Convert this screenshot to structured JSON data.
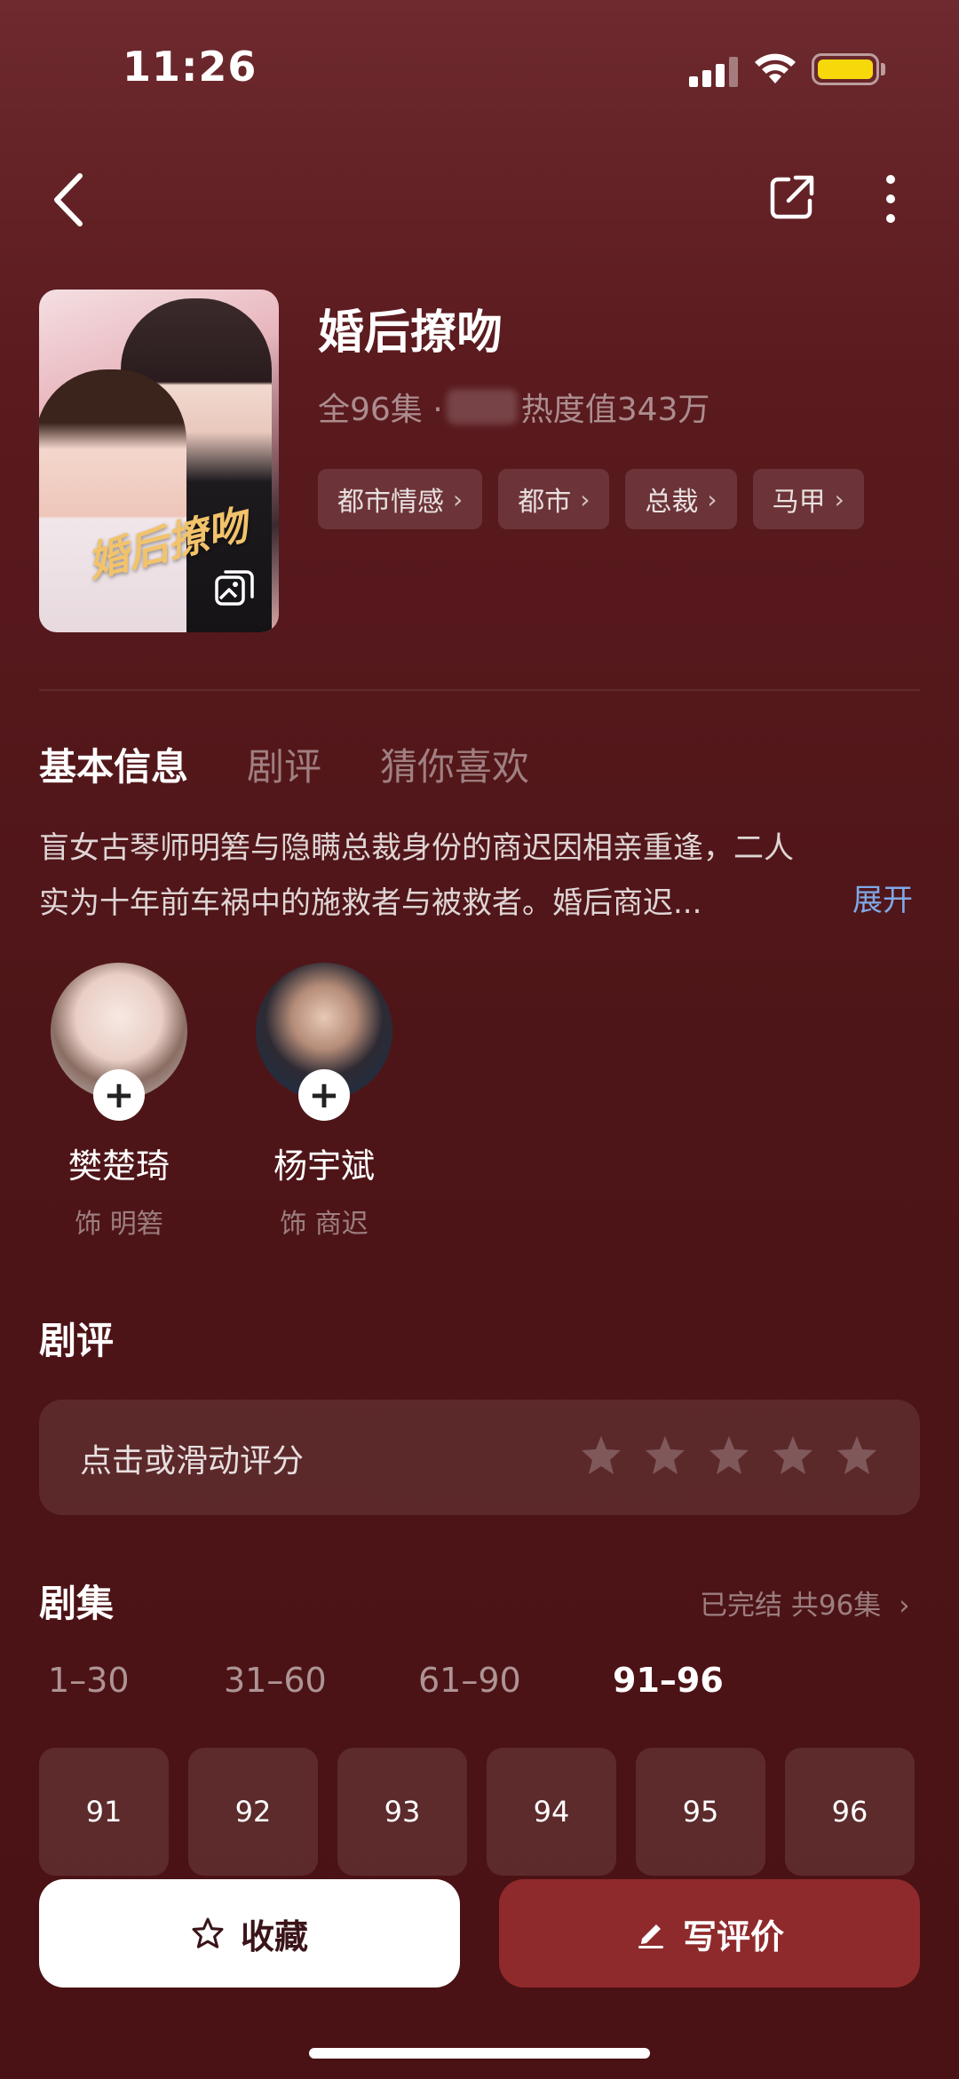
{
  "status_bar": {
    "time": "11:26"
  },
  "show": {
    "title": "婚后撩吻",
    "episodes_total_prefix": "全96集 ·",
    "heat": "热度值343万",
    "poster_title": "婚后撩吻",
    "tags": [
      {
        "label": "都市情感"
      },
      {
        "label": "都市"
      },
      {
        "label": "总裁"
      },
      {
        "label": "马甲"
      }
    ]
  },
  "tabs": [
    {
      "label": "基本信息",
      "active": true
    },
    {
      "label": "剧评",
      "active": false
    },
    {
      "label": "猜你喜欢",
      "active": false
    }
  ],
  "synopsis": {
    "line1": "盲女古琴师明箬与隐瞒总裁身份的商迟因相亲重逢，二人",
    "line2": "实为十年前车祸中的施救者与被救者。婚后商迟...",
    "expand_label": "展开"
  },
  "cast": [
    {
      "name": "樊楚琦",
      "role": "饰 明箬"
    },
    {
      "name": "杨宇斌",
      "role": "饰 商迟"
    }
  ],
  "reviews": {
    "title": "剧评",
    "rating_prompt": "点击或滑动评分",
    "star_count": 5
  },
  "episodes": {
    "title": "剧集",
    "status": "已完结 共96集",
    "ranges": [
      {
        "label": "1–30",
        "active": false
      },
      {
        "label": "31–60",
        "active": false
      },
      {
        "label": "61–90",
        "active": false
      },
      {
        "label": "91–96",
        "active": true
      }
    ],
    "items": [
      "91",
      "92",
      "93",
      "94",
      "95",
      "96"
    ]
  },
  "actions": {
    "favorite_label": "收藏",
    "review_label": "写评价"
  },
  "colors": {
    "accent_link": "#7fa9e8",
    "primary_button": "#8f2a2c",
    "battery": "#f5d90a"
  }
}
